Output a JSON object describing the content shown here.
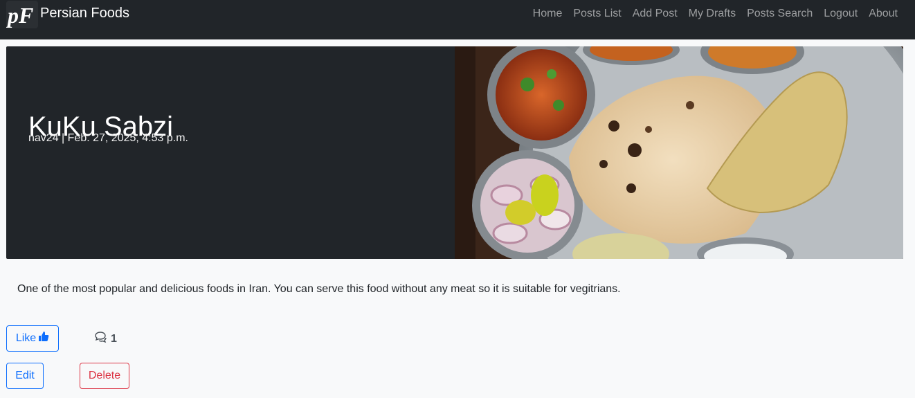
{
  "brand": {
    "logo_text": "pF",
    "name": "Persian Foods"
  },
  "nav": {
    "items": [
      {
        "label": "Home"
      },
      {
        "label": "Posts List"
      },
      {
        "label": "Add Post"
      },
      {
        "label": "My Drafts"
      },
      {
        "label": "Posts Search"
      },
      {
        "label": "Logout"
      },
      {
        "label": "About"
      }
    ]
  },
  "post": {
    "title": "KuKu Sabzi",
    "meta": "nav24 | Feb. 27, 2025, 4:53 p.m.",
    "excerpt": "One of the most popular and delicious foods in Iran. You can serve this food without any meat so it is suitable for vegitrians.",
    "image_icon": "food-platter-image"
  },
  "actions": {
    "like_label": "Like",
    "like_icon": "thumbs-up-icon",
    "comment_icon": "comment-icon",
    "comment_count": "1",
    "edit_label": "Edit",
    "delete_label": "Delete"
  },
  "colors": {
    "navbar": "#212529",
    "primary": "#0d6efd",
    "danger": "#dc3545",
    "page_bg": "#f8f9fa"
  }
}
